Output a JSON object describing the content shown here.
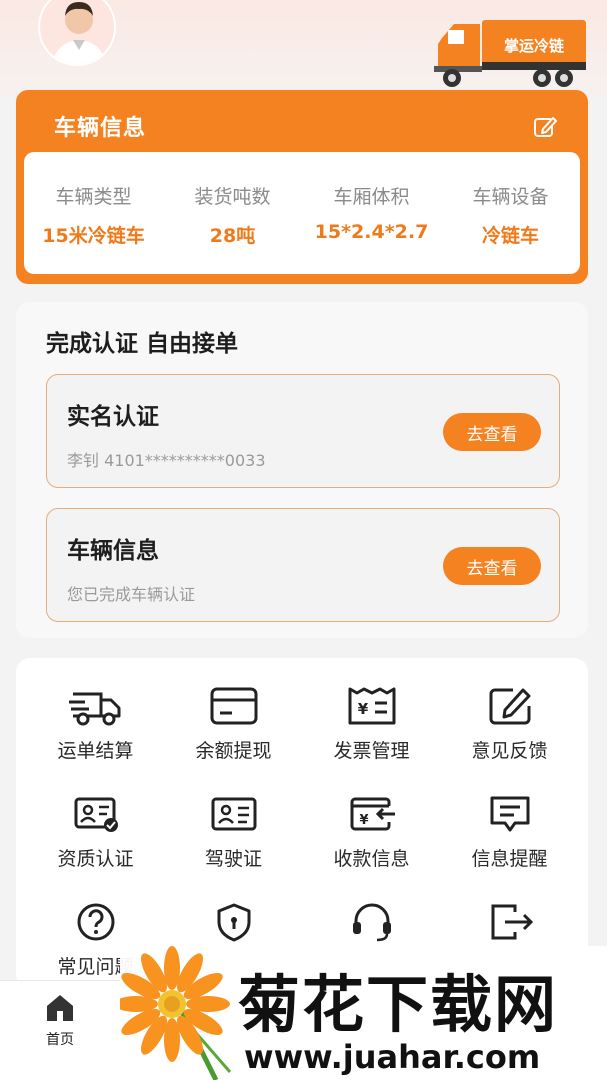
{
  "header": {
    "brand_text": "掌运冷链"
  },
  "vehicle": {
    "title": "车辆信息",
    "fields": [
      {
        "label": "车辆类型",
        "value": "15米冷链车"
      },
      {
        "label": "装货吨数",
        "value": "28吨"
      },
      {
        "label": "车厢体积",
        "value": "15*2.4*2.7"
      },
      {
        "label": "车辆设备",
        "value": "冷链车"
      }
    ]
  },
  "auth": {
    "title": "完成认证 自由接单",
    "cards": [
      {
        "title": "实名认证",
        "subtitle": "李钊 4101**********0033",
        "button": "去查看"
      },
      {
        "title": "车辆信息",
        "subtitle": "您已完成车辆认证",
        "button": "去查看"
      }
    ]
  },
  "menu": {
    "items": [
      {
        "label": "运单结算",
        "icon": "truck-icon"
      },
      {
        "label": "余额提现",
        "icon": "card-icon"
      },
      {
        "label": "发票管理",
        "icon": "invoice-icon"
      },
      {
        "label": "意见反馈",
        "icon": "feedback-icon"
      },
      {
        "label": "资质认证",
        "icon": "certificate-icon"
      },
      {
        "label": "驾驶证",
        "icon": "license-icon"
      },
      {
        "label": "收款信息",
        "icon": "payment-icon"
      },
      {
        "label": "信息提醒",
        "icon": "message-icon"
      },
      {
        "label": "常见问题",
        "icon": "question-icon"
      },
      {
        "label": "",
        "icon": "shield-icon"
      },
      {
        "label": "",
        "icon": "headset-icon"
      },
      {
        "label": "",
        "icon": "logout-icon"
      }
    ]
  },
  "tabbar": {
    "home_label": "首页"
  },
  "watermark": {
    "title": "菊花下载网",
    "url": "www.juahar.com"
  },
  "colors": {
    "accent": "#f58220",
    "value_text": "#f07a1a",
    "border": "#e6ad7c"
  }
}
